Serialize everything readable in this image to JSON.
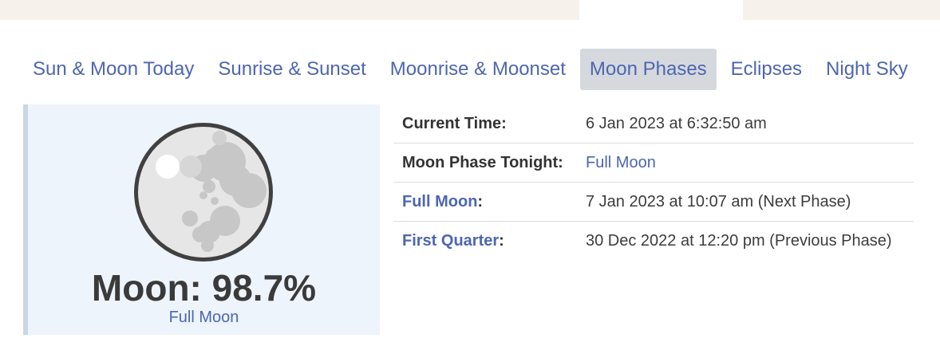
{
  "nav": {
    "tabs": [
      {
        "label": "Sun & Moon Today"
      },
      {
        "label": "Sunrise & Sunset"
      },
      {
        "label": "Moonrise & Moonset"
      },
      {
        "label": "Moon Phases",
        "active": true
      },
      {
        "label": "Eclipses"
      },
      {
        "label": "Night Sky"
      }
    ]
  },
  "moon": {
    "illumination": "Moon: 98.7%",
    "phase": "Full Moon"
  },
  "details": {
    "current_time_label": "Current Time:",
    "current_time_value": "6 Jan 2023 at 6:32:50 am",
    "tonight_label": "Moon Phase Tonight:",
    "tonight_value": "Full Moon",
    "next_label": "Full Moon",
    "next_suffix": ":",
    "next_value": "7 Jan 2023 at 10:07 am (Next Phase)",
    "prev_label": "First Quarter",
    "prev_suffix": ":",
    "prev_value": "30 Dec 2022 at 12:20 pm (Previous Phase)"
  },
  "colors": {
    "link": "#4e66b0",
    "active_tab_bg": "#d5d9de",
    "panel_bg": "#edf4fb",
    "panel_border": "#c9d7e3",
    "top_strip": "#f6f2eb"
  },
  "icons": {
    "moon": "full-moon-icon"
  }
}
